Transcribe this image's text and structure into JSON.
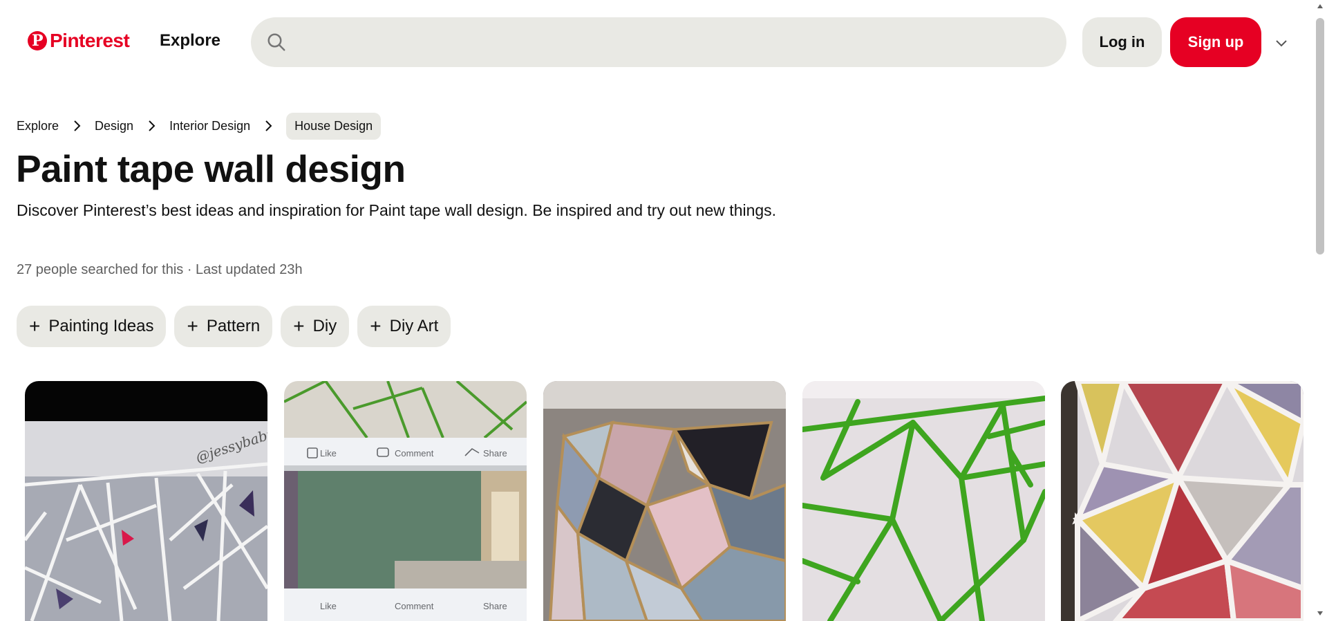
{
  "header": {
    "logo_text": "Pinterest",
    "logo_glyph": "P",
    "explore_label": "Explore",
    "search_placeholder": "",
    "login_label": "Log in",
    "signup_label": "Sign up",
    "brand_color": "#e60023"
  },
  "breadcrumb": {
    "items": [
      "Explore",
      "Design",
      "Interior Design"
    ],
    "current": "House Design"
  },
  "page": {
    "title": "Paint tape wall design",
    "description": "Discover Pinterest’s best ideas and inspiration for Paint tape wall design. Be inspired and try out new things.",
    "meta": "27 people searched for this · Last updated 23h"
  },
  "chips": [
    {
      "plus": "+",
      "label": "Painting Ideas"
    },
    {
      "plus": "+",
      "label": "Pattern"
    },
    {
      "plus": "+",
      "label": "Diy"
    },
    {
      "plus": "+",
      "label": "Diy Art"
    }
  ],
  "pins": [
    {
      "name": "gray-triangle-wall",
      "watermark": "@jessybaby"
    },
    {
      "name": "facebook-post-collage",
      "actions": [
        "Like",
        "Comment",
        "Share"
      ]
    },
    {
      "name": "pastel-geometric-wall"
    },
    {
      "name": "green-tape-wall"
    },
    {
      "name": "colorful-geometric-wall"
    }
  ],
  "icons": {
    "search": "search-icon",
    "chevron": "chevron-down-icon",
    "crumb_sep": "chevron-right-icon"
  }
}
